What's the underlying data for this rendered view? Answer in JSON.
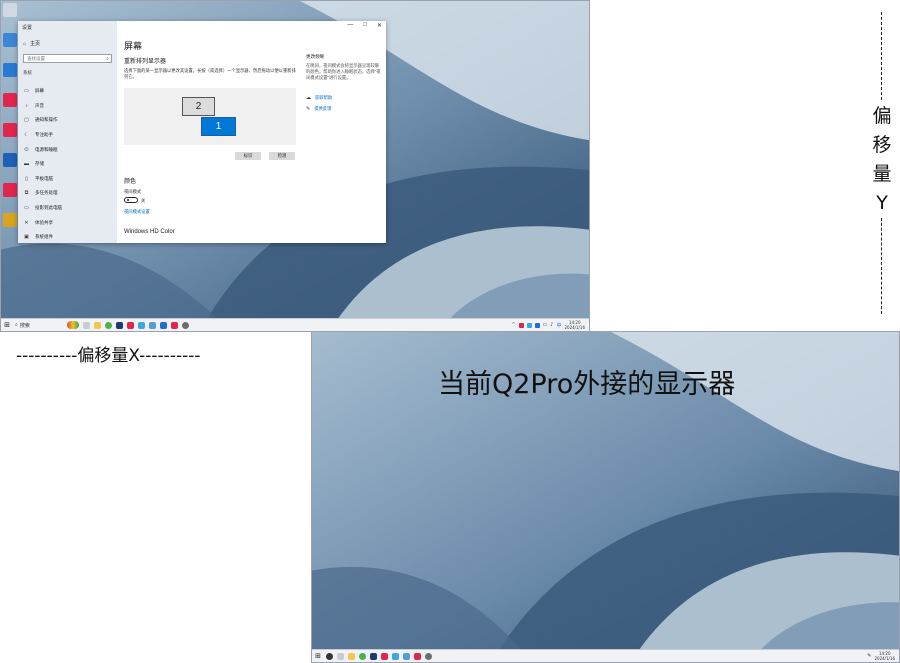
{
  "desktop_left": {
    "taskbar": {
      "start_icon": "windows-start-icon",
      "search_placeholder": "搜索",
      "pinned_app_icons": [
        "taskview-icon",
        "explorer-icon",
        "chrome-icon",
        "app-icon",
        "app-icon",
        "app-icon",
        "app-icon",
        "app-icon",
        "app-icon",
        "settings-icon"
      ],
      "clock_time": "14:20",
      "clock_date": "2024/1/16"
    }
  },
  "settings_window": {
    "title": "设置",
    "sidebar": {
      "home": "主页",
      "search_placeholder": "查找设置",
      "section": "系统",
      "items": [
        {
          "icon": "monitor-icon",
          "label": "屏幕"
        },
        {
          "icon": "sound-icon",
          "label": "声音"
        },
        {
          "icon": "notification-icon",
          "label": "通知和操作"
        },
        {
          "icon": "focus-icon",
          "label": "专注助手"
        },
        {
          "icon": "power-icon",
          "label": "电源和睡眠"
        },
        {
          "icon": "storage-icon",
          "label": "存储"
        },
        {
          "icon": "tablet-icon",
          "label": "平板电脑"
        },
        {
          "icon": "multitask-icon",
          "label": "多任务处理"
        },
        {
          "icon": "project-icon",
          "label": "投影到此电脑"
        },
        {
          "icon": "share-icon",
          "label": "体验共享"
        },
        {
          "icon": "info-icon",
          "label": "系统组件"
        }
      ]
    },
    "controls": {
      "minimize": "—",
      "maximize": "□",
      "close": "✕"
    },
    "main": {
      "title": "屏幕",
      "subtitle": "重新排列显示器",
      "description": "选择下面的某一显示器以更改其设置。长按（或选择）一个显示器，然后拖动以便以重新排列它。",
      "monitors": {
        "secondary": "2",
        "primary": "1"
      },
      "identify_button": "标识",
      "detect_button": "检测",
      "color_heading": "颜色",
      "night_light_label": "夜间模式",
      "night_light_state": "关",
      "night_light_link": "夜间模式设置",
      "hd_color_heading": "Windows HD Color"
    },
    "right_panel": {
      "title": "更改频晰",
      "text": "在晚间，夜间模式会将显示器呈现较暖的颜色，帮助你进入睡眠状态。选择\"夜间模式设置\"进行设置。",
      "links": [
        {
          "icon": "help-icon",
          "label": "获取帮助"
        },
        {
          "icon": "feedback-icon",
          "label": "提供反馈"
        }
      ]
    }
  },
  "desktop_right": {
    "taskbar": {
      "clock_time": "14:20",
      "clock_date": "2024/1/16"
    }
  },
  "annotations": {
    "offset_x": "----------偏移量X----------",
    "offset_y_chars": [
      "偏",
      "移",
      "量",
      "Y"
    ],
    "caption": "当前Q2Pro外接的显示器"
  },
  "colors": {
    "accent": "#0078d7",
    "wallpaper_dark": "#3e5d7f",
    "wallpaper_light": "#c9d8e4"
  }
}
